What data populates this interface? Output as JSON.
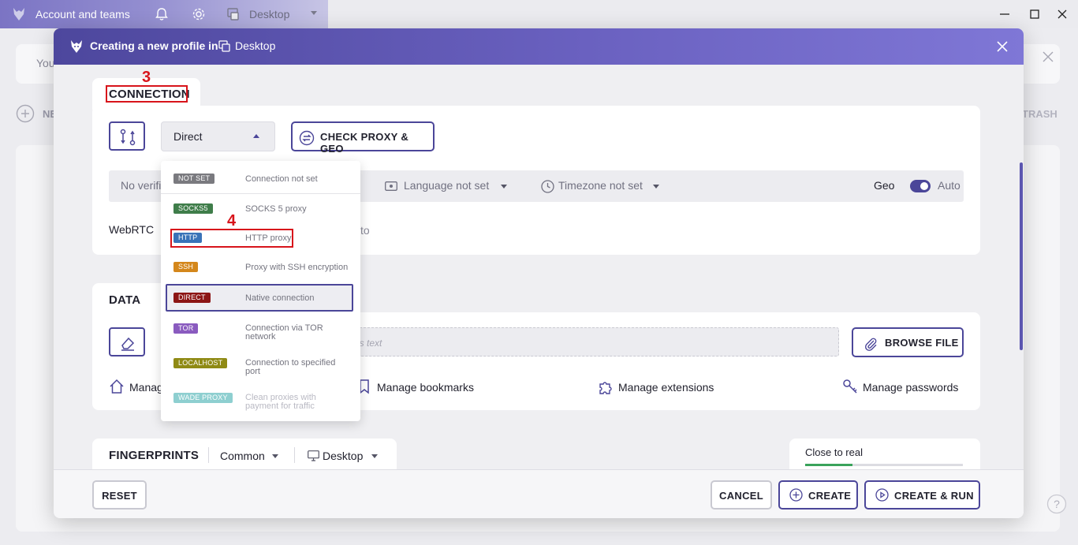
{
  "window": {
    "title": "Account and teams",
    "workspace": "Desktop",
    "icons": [
      "wolf-logo-icon",
      "bell-icon",
      "gear-icon",
      "desktop-icon",
      "minimize-icon",
      "maximize-icon",
      "close-icon"
    ]
  },
  "background": {
    "notice_text": "You",
    "new_label": "NE",
    "trash_label": "TRASH"
  },
  "modal": {
    "title": "Creating a new profile in",
    "workspace": "Desktop",
    "connection": {
      "tab_label": "CONNECTION",
      "selected_type": "Direct",
      "check_button": "CHECK PROXY & GEO",
      "no_verified": "No verifi",
      "language": "Language not set",
      "timezone": "Timezone not set",
      "geo_label": "Geo",
      "geo_mode": "Auto",
      "geo_auto": true,
      "webrtc_label": "WebRTC",
      "webrtc_value": "to"
    },
    "proxy_menu": [
      {
        "badge": "NOT SET",
        "desc": "Connection not set",
        "color": "#7a7a7f"
      },
      {
        "badge": "SOCKS5",
        "desc": "SOCKS 5 proxy",
        "color": "#3f7d4a"
      },
      {
        "badge": "HTTP",
        "desc": "HTTP proxy",
        "color": "#3a73b8"
      },
      {
        "badge": "SSH",
        "desc": "Proxy with SSH encryption",
        "color": "#d4871b"
      },
      {
        "badge": "DIRECT",
        "desc": "Native connection",
        "color": "#8c1515"
      },
      {
        "badge": "TOR",
        "desc": "Connection via TOR network",
        "color": "#8a5bbf"
      },
      {
        "badge": "LOCALHOST",
        "desc": "Connection to specified port",
        "color": "#8f8a14"
      },
      {
        "badge": "WADE PROXY",
        "desc": "Clean proxies with payment for traffic",
        "color": "#8ecfd0"
      }
    ],
    "data": {
      "tab_label": "DATA",
      "drop_placeholder": "as text",
      "browse_button": "BROWSE FILE",
      "links": [
        "Manag",
        "Manage bookmarks",
        "Manage extensions",
        "Manage passwords"
      ]
    },
    "fingerprints": {
      "tab_label": "FINGERPRINTS",
      "mode": "Common",
      "platform": "Desktop",
      "closeness_label": "Close to real",
      "closeness_level": 0.3
    },
    "footer": {
      "reset": "RESET",
      "cancel": "CANCEL",
      "create": "CREATE",
      "create_run": "CREATE & RUN"
    }
  },
  "annotations": {
    "step3": "3",
    "step4": "4",
    "color": "#d8141b"
  },
  "colors": {
    "accent": "#4b4699",
    "header": "#6a61c0",
    "background": "#ececf0"
  }
}
